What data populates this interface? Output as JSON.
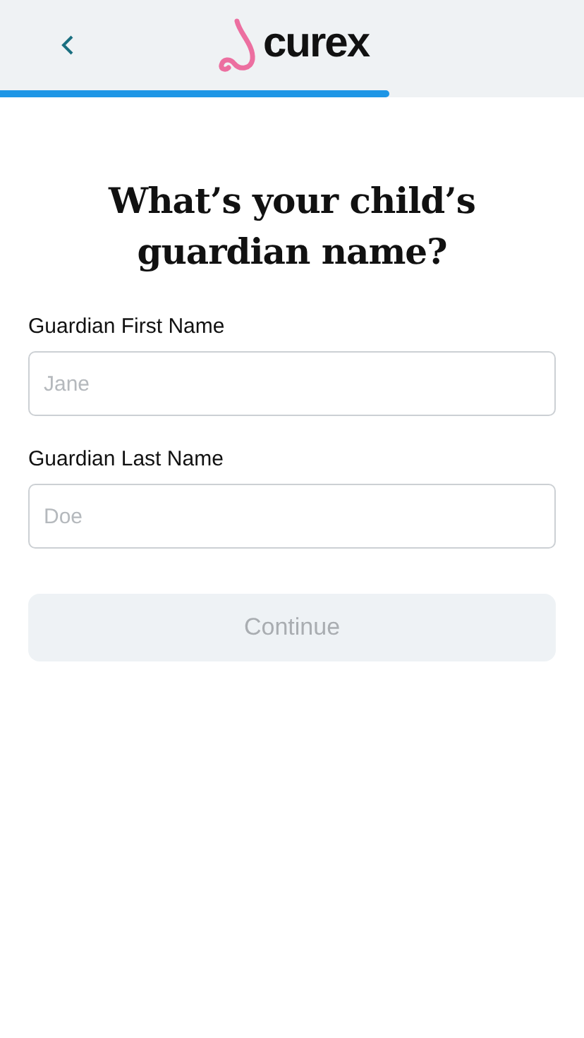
{
  "header": {
    "logo_text": "curex",
    "progress": {
      "level": 0.667
    }
  },
  "title": "What’s your child’s guardian name?",
  "fields": [
    {
      "label": "Guardian First Name",
      "placeholder": "Jane"
    },
    {
      "label": "Guardian Last Name",
      "placeholder": "Doe"
    }
  ],
  "continue_button": {
    "label": "Continue",
    "disabled": true
  }
}
